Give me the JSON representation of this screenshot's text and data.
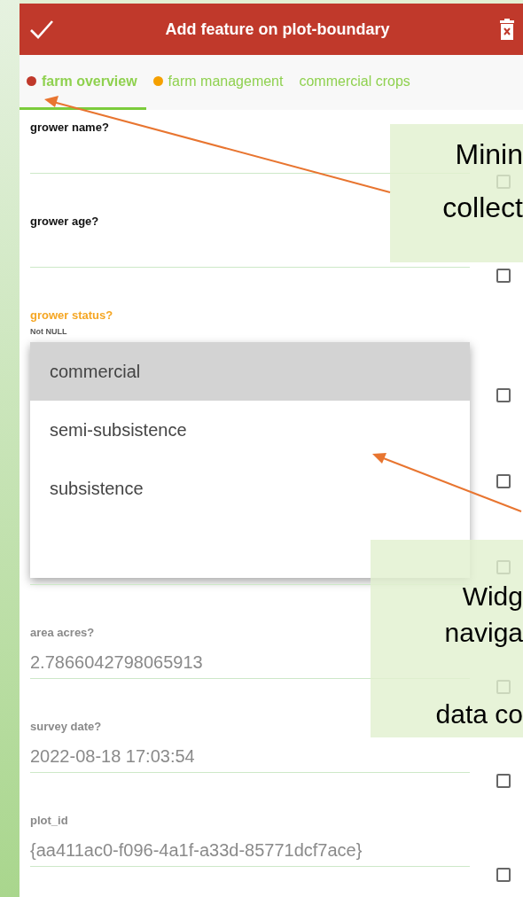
{
  "header": {
    "title": "Add feature on plot-boundary"
  },
  "tabs": [
    {
      "label": "farm overview",
      "selected": true,
      "color": "#c0392b"
    },
    {
      "label": "farm management",
      "selected": false,
      "color": "#f5a000"
    },
    {
      "label": "commercial crops",
      "selected": false
    }
  ],
  "fields": [
    {
      "label": "grower name?",
      "kind": "text",
      "editable": true,
      "constraint_failed": false,
      "checks": [
        false
      ]
    },
    {
      "label": "grower age?",
      "kind": "text",
      "editable": true,
      "constraint_failed": false,
      "checks": [
        false
      ]
    },
    {
      "label": "grower status?",
      "kind": "dropdown",
      "editable": true,
      "constraint_failed": true,
      "hint": "Not NULL",
      "checks": [
        false,
        false,
        false
      ],
      "options": [
        {
          "label": "commercial",
          "selected": true
        },
        {
          "label": "semi-subsistence",
          "selected": false
        },
        {
          "label": "subsistence",
          "selected": false
        }
      ]
    },
    {
      "label": "area acres?",
      "kind": "text",
      "editable": false,
      "constraint_failed": false,
      "value": "2.7866042798065913",
      "checks": [
        false
      ]
    },
    {
      "label": "survey date?",
      "kind": "text",
      "editable": false,
      "constraint_failed": false,
      "value": "2022-08-18 17:03:54",
      "checks": [
        false
      ]
    },
    {
      "label": "plot_id",
      "kind": "text",
      "editable": false,
      "constraint_failed": false,
      "value": "{aa411ac0-f096-4a1f-a33d-85771dcf7ace}",
      "checks": [
        false
      ]
    }
  ],
  "callouts": [
    {
      "lines": [
        "Minin",
        "collect"
      ]
    },
    {
      "lines": [
        "Widg",
        "naviga",
        "data co"
      ]
    }
  ]
}
